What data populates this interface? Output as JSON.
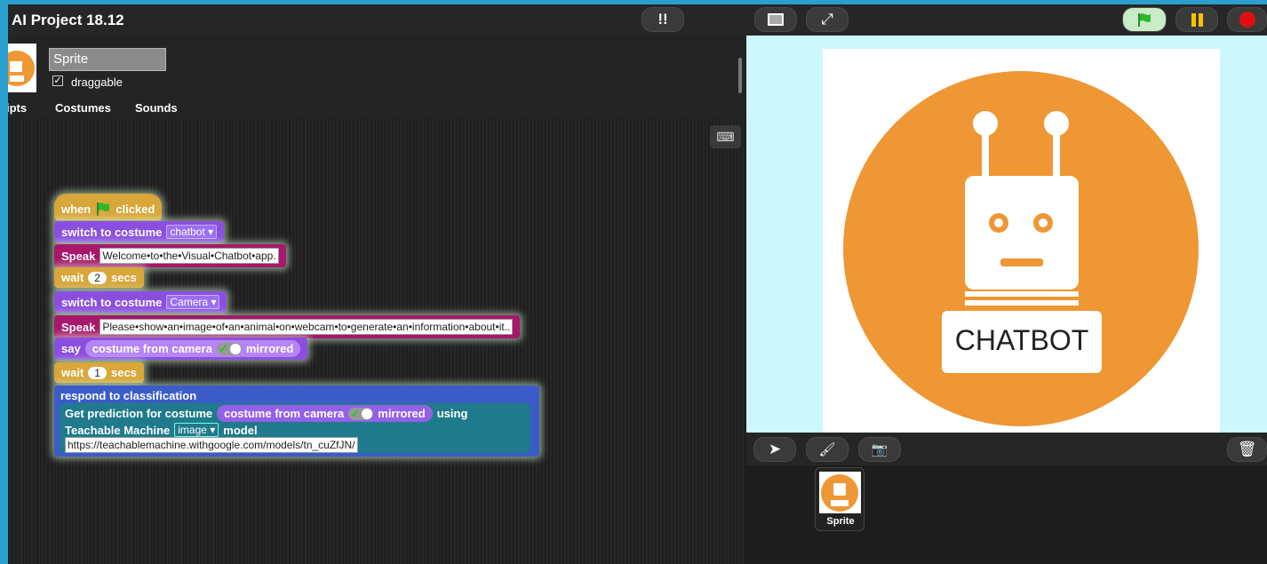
{
  "app": {
    "title": "AI Project 18.12"
  },
  "sprite": {
    "name": "Sprite",
    "draggable_label": "draggable",
    "draggable_checked": "✓"
  },
  "tabs": [
    "ipts",
    "Costumes",
    "Sounds"
  ],
  "keyboard_icon": "keyboard-icon",
  "blocks": {
    "when": "when",
    "clicked": "clicked",
    "switch1": "switch to costume",
    "costume1": "chatbot",
    "speak1_label": "Speak",
    "speak1_text": "Welcome•to•the•Visual•Chatbot•app.",
    "wait1_label": "wait",
    "wait1_value": "2",
    "wait1_unit": "secs",
    "switch2": "switch to costume",
    "costume2": "Camera",
    "speak2_label": "Speak",
    "speak2_text": "Please•show•an•image•of•an•animal•on•webcam•to•generate•an•information•about•it..",
    "say_label": "say",
    "say_rep": "costume from camera",
    "say_mirror": "mirrored",
    "wait2_label": "wait",
    "wait2_value": "1",
    "wait2_unit": "secs",
    "respond": "respond to classification",
    "getpred": "Get prediction for costume",
    "getpred_rep": "costume from camera",
    "getpred_mirror": "mirrored",
    "using": "using",
    "tm_label": "Teachable Machine",
    "tm_type": "image",
    "tm_model": "model",
    "url": "https://teachablemachine.withgoogle.com/models/tn_cuZfJN/"
  },
  "stage": {
    "costume_text": "CHATBOT",
    "colors": {
      "orange": "#ee9734",
      "stage_bg": "#ccf8fd"
    }
  },
  "corral": {
    "sprite_label": "Sprite"
  }
}
